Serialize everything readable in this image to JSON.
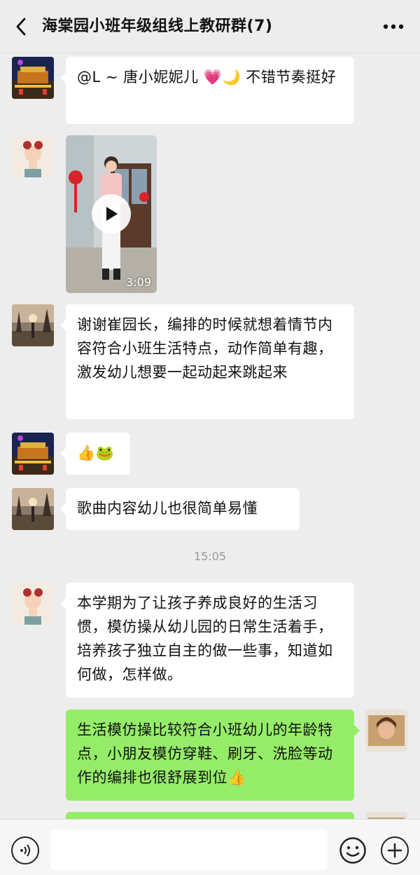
{
  "header": {
    "title": "海棠园小班年级组线上教研群(7)",
    "back_icon": "chevron-left-icon",
    "more_icon": "more-dots-icon"
  },
  "messages": [
    {
      "sender": "other",
      "avatar": "avatar-night-scene",
      "text": "@L ~ 唐小妮妮儿 💗🌙  不错节奏挺好"
    },
    {
      "sender": "other",
      "avatar": "avatar-cartoon-girl",
      "type": "video",
      "duration": "3:09"
    },
    {
      "sender": "other",
      "avatar": "avatar-sunset-tree",
      "text": "谢谢崔园长，编排的时候就想着情节内容符合小班生活特点，动作简单有趣，激发幼儿想要一起动起来跳起来"
    },
    {
      "sender": "other",
      "avatar": "avatar-night-scene",
      "text": "👍🐸"
    },
    {
      "sender": "other",
      "avatar": "avatar-sunset-tree",
      "text": "歌曲内容幼儿也很简单易懂"
    },
    {
      "type": "time",
      "text": "15:05"
    },
    {
      "sender": "other",
      "avatar": "avatar-cartoon-girl",
      "text": "本学期为了让孩子养成良好的生活习惯，模仿操从幼儿园的日常生活着手，培养孩子独立自主的做一些事，知道如何做，怎样做。"
    },
    {
      "sender": "self",
      "avatar": "avatar-self-photo",
      "text": "生活模仿操比较符合小班幼儿的年龄特点，小朋友模仿穿鞋、刷牙、洗脸等动作的编排也很舒展到位👍"
    }
  ],
  "input": {
    "placeholder": "",
    "voice_icon": "voice-icon",
    "emoji_icon": "emoji-icon",
    "plus_icon": "plus-icon"
  },
  "colors": {
    "background": "#ededed",
    "bubble_other": "#ffffff",
    "bubble_self": "#95ec69"
  }
}
